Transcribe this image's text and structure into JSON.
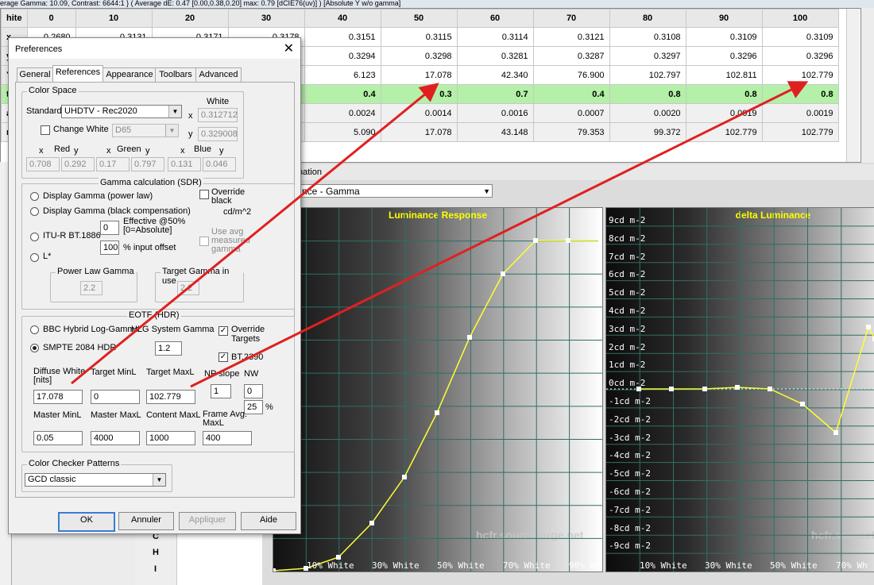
{
  "status_bar": "erage Gamma: 10.09, Contrast: 6644:1 } ( Average dE: 0.47 [0.00,0.38,0.20] max: 0.79 [dCIE76(uv)] ) [Absolute Y w/o gamma]",
  "table": {
    "corner": "hite",
    "columns": [
      "0",
      "10",
      "20",
      "30",
      "40",
      "50",
      "60",
      "70",
      "80",
      "90",
      "100"
    ],
    "rows": [
      {
        "label": "x",
        "cells": [
          "0.2680",
          "0.3131",
          "0.3171",
          "0.3178",
          "0.3151",
          "0.3115",
          "0.3114",
          "0.3121",
          "0.3108",
          "0.3109",
          "0.3109"
        ]
      },
      {
        "label": "y",
        "cells": [
          "",
          "",
          "",
          "0.3297",
          "0.3294",
          "0.3298",
          "0.3281",
          "0.3287",
          "0.3297",
          "0.3296",
          "0.3296"
        ]
      },
      {
        "label": "Y",
        "cells": [
          "",
          "",
          "",
          "894",
          "6.123",
          "17.078",
          "42.340",
          "76.900",
          "102.797",
          "102.811",
          "102.779"
        ]
      },
      {
        "label": "ta",
        "cells": [
          "",
          "",
          "",
          "0.4",
          "0.4",
          "0.3",
          "0.7",
          "0.4",
          "0.8",
          "0.8",
          "0.8"
        ]
      },
      {
        "label": "a",
        "cells": [
          "",
          "",
          "",
          "0051",
          "0.0024",
          "0.0014",
          "0.0016",
          "0.0007",
          "0.0020",
          "0.0019",
          "0.0019"
        ]
      },
      {
        "label": "rg",
        "cells": [
          "",
          "",
          "",
          "848",
          "5.090",
          "17.078",
          "43.148",
          "79.353",
          "99.372",
          "102.779",
          "102.779"
        ]
      }
    ]
  },
  "charts_panel": {
    "title_fragment": "nation",
    "select_value": "nce - Gamma",
    "luminance": {
      "title": "Luminance Response",
      "watermark": "hcfr.sourceforge.net",
      "x_ticks": [
        "10% White",
        "30% White",
        "50% White",
        "70% White",
        "90% Wh"
      ]
    },
    "delta": {
      "title": "delta Luminance",
      "watermark": "hcfr.sourceforge",
      "y_ticks": [
        "9cd m-2",
        "8cd m-2",
        "7cd m-2",
        "6cd m-2",
        "5cd m-2",
        "4cd m-2",
        "3cd m-2",
        "2cd m-2",
        "1cd m-2",
        "0cd m-2",
        "-1cd m-2",
        "-2cd m-2",
        "-3cd m-2",
        "-4cd m-2",
        "-5cd m-2",
        "-6cd m-2",
        "-7cd m-2",
        "-8cd m-2",
        "-9cd m-2"
      ],
      "x_ticks": [
        "10% White",
        "30% White",
        "50% White",
        "70% Wh"
      ]
    }
  },
  "chrows": [
    "C",
    "H",
    "I"
  ],
  "dialog": {
    "title": "Preferences",
    "tabs": [
      "General",
      "References",
      "Appearance",
      "Toolbars",
      "Advanced"
    ],
    "active_tab": "References",
    "color_space": {
      "label": "Color Space",
      "standard_label": "Standard:",
      "standard_value": "UHDTV - Rec2020",
      "change_white_label": "Change White",
      "white_select": "D65",
      "white_label": "White",
      "white_x_label": "x",
      "white_y_label": "y",
      "white_x": "0.312712",
      "white_y": "0.329008",
      "red_label": "Red",
      "green_label": "Green",
      "blue_label": "Blue",
      "x_label": "x",
      "y_label": "y",
      "red": [
        "0.708",
        "0.292"
      ],
      "green": [
        "0.17",
        "0.797"
      ],
      "blue": [
        "0.131",
        "0.046"
      ]
    },
    "gamma_sdr": {
      "label": "Gamma calculation (SDR)",
      "opt_power": "Display Gamma (power law)",
      "opt_black": "Display Gamma (black compensation)",
      "opt_bt1886": "ITU-R BT.1886",
      "opt_lstar": "L*",
      "override_black": "Override black",
      "cdm2": "cd/m^2",
      "effective_label": "Effective @50% [0=Absolute]",
      "effective_value": "0",
      "offset_value": "100",
      "offset_label": "% input offset",
      "use_avg": "Use avg measured gamma",
      "power_law_label": "Power Law Gamma",
      "power_law_value": "2.2",
      "target_gamma_label": "Target Gamma in use",
      "target_gamma_value": "2.2"
    },
    "eotf": {
      "label": "EOTF (HDR)",
      "opt_hlg": "BBC Hybrid Log-Gamma",
      "hlg_sys": "HLG System Gamma",
      "hlg_value": "1.2",
      "opt_smpte": "SMPTE 2084 HDR",
      "override_targets": "Override Targets",
      "bt2390": "BT.2390",
      "diffuse_label": "Diffuse White [nits]",
      "diffuse_value": "17.078",
      "target_minl_label": "Target MinL",
      "target_minl_value": "0",
      "target_maxl_label": "Target MaxL",
      "target_maxl_value": "102.779",
      "np_slope_label": "NP slope",
      "np_slope_value": "1",
      "nw_label": "NW",
      "nw_value": "0",
      "pct_value": "25",
      "pct_label": "%",
      "master_minl_label": "Master MinL",
      "master_minl_value": "0.05",
      "master_maxl_label": "Master MaxL",
      "master_maxl_value": "4000",
      "content_maxl_label": "Content MaxL",
      "content_maxl_value": "1000",
      "frame_avg_label": "Frame Avg. MaxL",
      "frame_avg_value": "400"
    },
    "color_checker": {
      "label": "Color Checker Patterns",
      "value": "GCD classic"
    },
    "buttons": {
      "ok": "OK",
      "cancel": "Annuler",
      "apply": "Appliquer",
      "help": "Aide"
    }
  }
}
